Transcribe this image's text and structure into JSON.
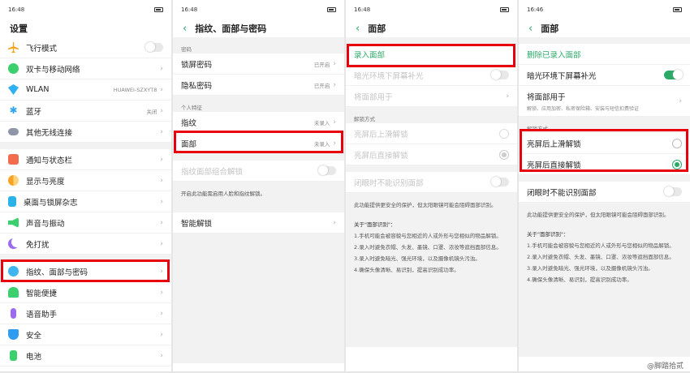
{
  "panel1": {
    "time": "16:48",
    "title": "设置",
    "items": [
      {
        "label": "飞行模式"
      },
      {
        "label": "双卡与移动网络"
      },
      {
        "label": "WLAN",
        "value": "HUAWEI-SZXYT8"
      },
      {
        "label": "蓝牙",
        "value": "关闭"
      },
      {
        "label": "其他无线连接"
      },
      {
        "label": "通知与状态栏"
      },
      {
        "label": "显示与亮度"
      },
      {
        "label": "桌面与锁屏杂志"
      },
      {
        "label": "声音与振动"
      },
      {
        "label": "免打扰"
      },
      {
        "label": "指纹、面部与密码"
      },
      {
        "label": "智能便捷"
      },
      {
        "label": "语音助手"
      },
      {
        "label": "安全"
      },
      {
        "label": "电池"
      }
    ]
  },
  "panel2": {
    "time": "16:48",
    "title": "指纹、面部与密码",
    "section_password": "密码",
    "lock_password": "锁屏密码",
    "lock_value": "已开启",
    "privacy_password": "隐私密码",
    "privacy_value": "已开启",
    "section_personal": "个人特征",
    "fingerprint": "指纹",
    "fingerprint_value": "未录入",
    "face": "面部",
    "face_value": "未录入",
    "combo": "指纹面部组合解锁",
    "combo_note": "开启此功能需启用人脸和指纹解锁。",
    "smart_unlock": "智能解锁"
  },
  "panel3": {
    "time": "16:48",
    "title": "面部",
    "enroll": "录入面部",
    "fill_light": "暗光环境下屏幕补光",
    "use_face_for": "将面部用于",
    "section_unlock": "解锁方式",
    "swipe_unlock": "亮屏后上滑解锁",
    "direct_unlock": "亮屏后直接解锁",
    "eyes_closed": "闭眼时不能识别面部",
    "note": "此功能提供更安全的保护，但太阳眼镜可能会阻碍面部识别。",
    "about_title": "关于\"面部识别\"：",
    "about": [
      "1.手机可能会被容貌与您相近的人或外形与您相似的物品解锁。",
      "2.录入时避免衣帽、头发、墨镜、口罩、浓妆等遮挡面部信息。",
      "3.录入时避免暗光、强光环境，以及摄像机镜头污浊。",
      "4.确保头像清晰、易识别，提高识别成功率。"
    ]
  },
  "panel4": {
    "time": "16:46",
    "title": "面部",
    "delete": "删除已录入面部",
    "fill_light": "暗光环境下屏幕补光",
    "use_face_for": "将面部用于",
    "use_face_sub": "解锁、应用加密、私密保险箱、安装与短信扣费验证",
    "section_unlock": "解锁方式",
    "swipe_unlock": "亮屏后上滑解锁",
    "direct_unlock": "亮屏后直接解锁",
    "eyes_closed": "闭眼时不能识别面部",
    "note": "此功能提供更安全的保护，但太阳眼镜可能会阻碍面部识别。",
    "about_title": "关于\"面部识别\"：",
    "about": [
      "1.手机可能会被容貌与您相近的人或外形与您相似的物品解锁。",
      "2.录入时避免衣帽、头发、墨镜、口罩、浓妆等遮挡面部信息。",
      "3.录入时避免暗光、强光环境，以及摄像机镜头污浊。",
      "4.确保头像清晰、易识别，提高识别成功率。"
    ]
  },
  "watermark": "@脚踏拾贰",
  "colors": {
    "accent": "#2aa967",
    "highlight": "#e8000d"
  }
}
